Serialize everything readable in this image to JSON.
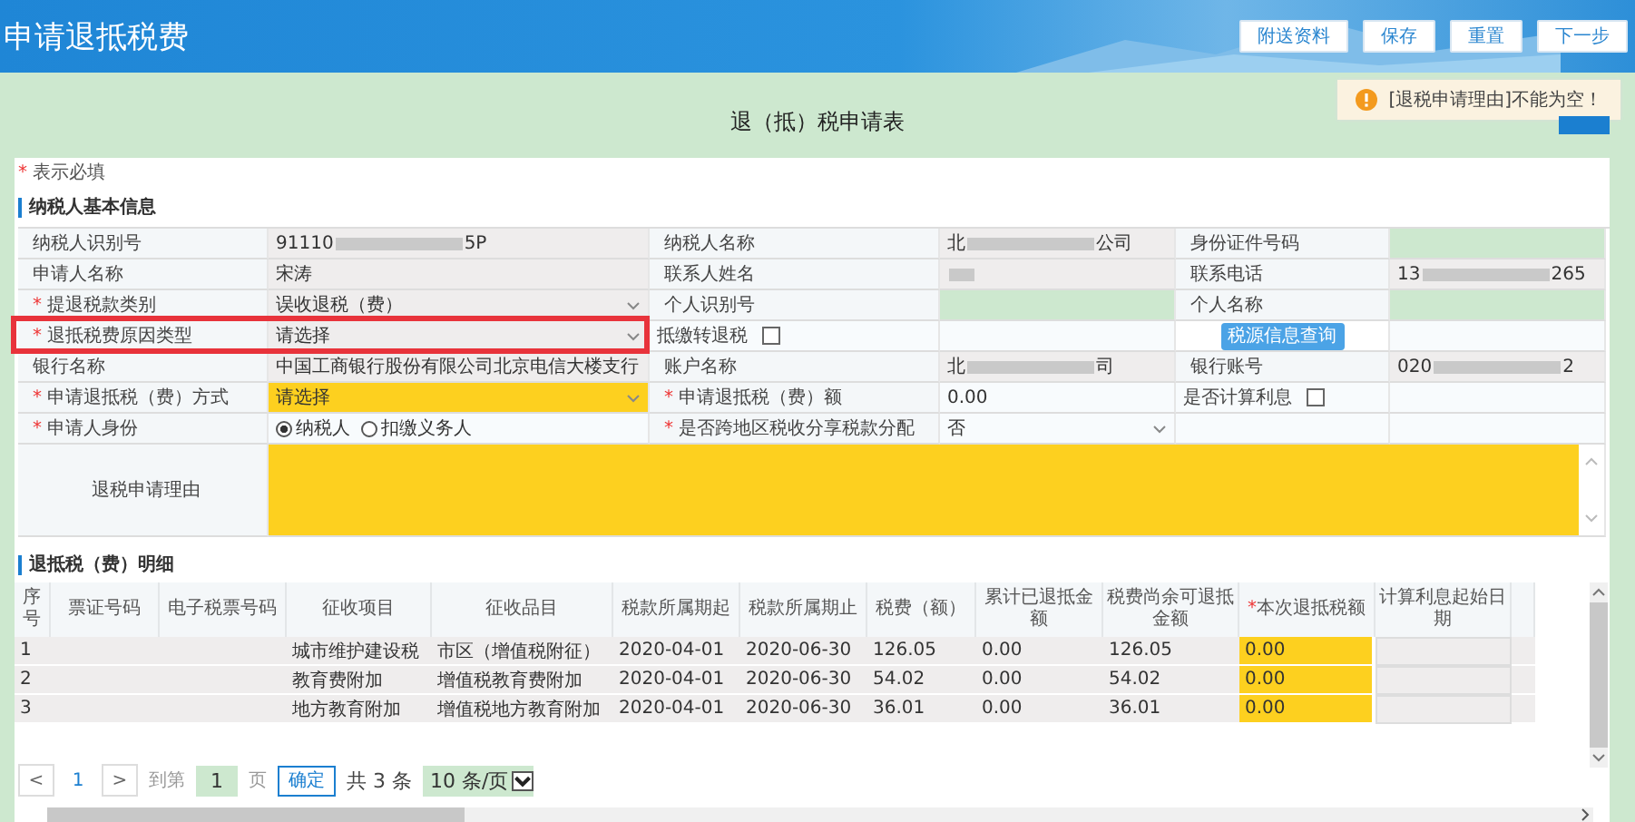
{
  "header": {
    "title": "申请退抵税费",
    "buttons": [
      "附送资料",
      "保存",
      "重置",
      "下一步"
    ]
  },
  "toast": {
    "kind": "warning",
    "text": "[退税申请理由]不能为空！"
  },
  "form_title": "退（抵）税申请表",
  "required_note": {
    "mark": "*",
    "text": "表示必填"
  },
  "basic_section": {
    "title": "纳税人基本信息",
    "annotation": {
      "kind": "red-box"
    },
    "rows": [
      {
        "highlighted": false,
        "cells": [
          {
            "kind": "label",
            "text": "纳税人识别号"
          },
          {
            "kind": "redacted",
            "parts": [
              "91110",
              "5P"
            ]
          },
          {
            "kind": "label",
            "text": "纳税人名称"
          },
          {
            "kind": "redacted",
            "parts": [
              "北",
              "公司"
            ]
          },
          {
            "kind": "label",
            "text": "身份证件号码"
          },
          {
            "kind": "blank"
          }
        ]
      },
      {
        "highlighted": false,
        "cells": [
          {
            "kind": "label",
            "text": "申请人名称"
          },
          {
            "kind": "text",
            "text": "宋涛"
          },
          {
            "kind": "label",
            "text": "联系人姓名"
          },
          {
            "kind": "redacted"
          },
          {
            "kind": "label",
            "text": "联系电话"
          },
          {
            "kind": "redacted",
            "parts": [
              "13",
              "265"
            ]
          }
        ]
      },
      {
        "highlighted": false,
        "cells": [
          {
            "kind": "label",
            "mark": "*",
            "text": "提退税款类别"
          },
          {
            "kind": "select",
            "text": "误收退税（费）",
            "invalid": false
          },
          {
            "kind": "label",
            "text": "个人识别号"
          },
          {
            "kind": "blank"
          },
          {
            "kind": "label",
            "text": "个人名称"
          },
          {
            "kind": "blank"
          }
        ]
      },
      {
        "highlighted": true,
        "cells": [
          {
            "kind": "label",
            "mark": "*",
            "text": "退抵税费原因类型"
          },
          {
            "kind": "select",
            "text": "请选择",
            "invalid": false
          },
          {
            "kind": "check",
            "text": "抵缴转退税",
            "checked": false
          },
          {
            "kind": "empty"
          },
          {
            "kind": "button",
            "text": "税源信息查询"
          },
          {
            "kind": "empty"
          }
        ]
      },
      {
        "highlighted": false,
        "cells": [
          {
            "kind": "label",
            "text": "银行名称"
          },
          {
            "kind": "text",
            "text": "中国工商银行股份有限公司北京电信大楼支行"
          },
          {
            "kind": "label",
            "text": "账户名称"
          },
          {
            "kind": "redacted",
            "parts": [
              "北",
              "司"
            ]
          },
          {
            "kind": "label",
            "text": "银行账号"
          },
          {
            "kind": "redacted",
            "parts": [
              "020",
              "2"
            ]
          }
        ]
      },
      {
        "highlighted": false,
        "cells": [
          {
            "kind": "label",
            "mark": "*",
            "text": "申请退抵税（费）方式"
          },
          {
            "kind": "select",
            "text": "请选择",
            "invalid": true
          },
          {
            "kind": "label",
            "mark": "*",
            "text": "申请退抵税（费）额"
          },
          {
            "kind": "input",
            "text": "0.00"
          },
          {
            "kind": "check",
            "text": "是否计算利息",
            "checked": false
          },
          {
            "kind": "empty"
          }
        ]
      },
      {
        "highlighted": false,
        "cells": [
          {
            "kind": "label",
            "mark": "*",
            "text": "申请人身份"
          },
          {
            "kind": "radios",
            "options": [
              {
                "label": "纳税人",
                "selected": true
              },
              {
                "label": "扣缴义务人",
                "selected": false
              }
            ]
          },
          {
            "kind": "label",
            "mark": "*",
            "text": "是否跨地区税收分享税款分配"
          },
          {
            "kind": "select",
            "text": "否",
            "invalid": false
          },
          {
            "kind": "empty"
          },
          {
            "kind": "empty"
          }
        ]
      },
      {
        "highlighted": false,
        "cells": [
          {
            "kind": "label",
            "text": "退税申请理由"
          },
          {
            "kind": "textarea",
            "invalid": true
          }
        ]
      }
    ]
  },
  "detail_section": {
    "title": "退抵税（费）明细",
    "columns": [
      {
        "kind": "text",
        "text": "序号"
      },
      {
        "kind": "text",
        "text": "票证号码"
      },
      {
        "kind": "text",
        "text": "电子税票号码"
      },
      {
        "kind": "text",
        "text": "征收项目"
      },
      {
        "kind": "text",
        "text": "征收品目"
      },
      {
        "kind": "text",
        "text": "税款所属期起"
      },
      {
        "kind": "text",
        "text": "税款所属期止"
      },
      {
        "kind": "text",
        "text": "税费（额）"
      },
      {
        "kind": "text",
        "text": "累计已退抵金额"
      },
      {
        "kind": "text",
        "text": "税费尚余可退抵金额"
      },
      {
        "kind": "input",
        "mark": "*",
        "text": "本次退抵税额"
      },
      {
        "kind": "box",
        "text": "计算利息起始日期"
      },
      {
        "kind": "text"
      }
    ],
    "rows": [
      [
        "1",
        "",
        "",
        "城市维护建设税",
        "市区（增值税附征）",
        "2020-04-01",
        "2020-06-30",
        "126.05",
        "0.00",
        "126.05",
        "0.00",
        "",
        ""
      ],
      [
        "2",
        "",
        "",
        "教育费附加",
        "增值税教育费附加",
        "2020-04-01",
        "2020-06-30",
        "54.02",
        "0.00",
        "54.02",
        "0.00",
        "",
        ""
      ],
      [
        "3",
        "",
        "",
        "地方教育附加",
        "增值税地方教育附加",
        "2020-04-01",
        "2020-06-30",
        "36.01",
        "0.00",
        "36.01",
        "0.00",
        "",
        ""
      ]
    ],
    "pagination": {
      "prev": "<",
      "page": "1",
      "next": ">",
      "goto_label": "到第",
      "goto_value": "1",
      "page_unit": "页",
      "confirm": "确定",
      "total": "共 3 条",
      "page_size": "10 条/页"
    }
  }
}
